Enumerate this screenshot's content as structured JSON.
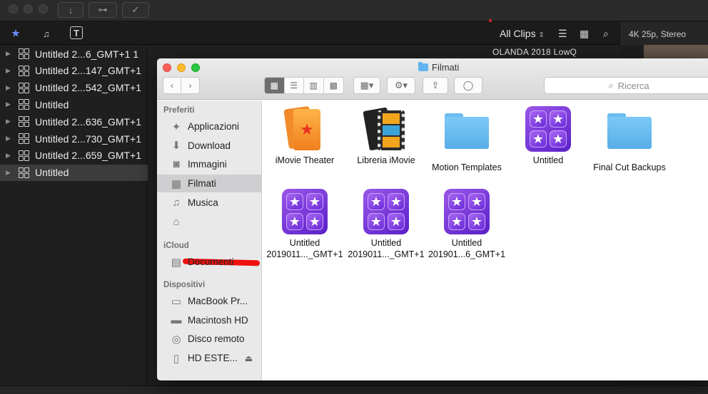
{
  "fcp": {
    "toolbar": {
      "import_icon": "↓",
      "key_icon": "⊶",
      "check_icon": "✓"
    },
    "library_tabs": [
      {
        "name": "libraries-tab",
        "glyph": "★"
      },
      {
        "name": "photos-audio-tab",
        "glyph": "♫"
      },
      {
        "name": "titles-tab",
        "glyph": "T"
      }
    ],
    "filter": {
      "label": "All Clips",
      "chevron": "⌃⌄"
    },
    "format_info": "4K 25p, Stereo",
    "clip_name": "OLANDA 2018 LowQ",
    "libraries": [
      {
        "label": "Untitled 2...6_GMT+1 1",
        "selected": false
      },
      {
        "label": "Untitled 2...147_GMT+1",
        "selected": false
      },
      {
        "label": "Untitled 2...542_GMT+1",
        "selected": false
      },
      {
        "label": "Untitled",
        "selected": false
      },
      {
        "label": "Untitled 2...636_GMT+1",
        "selected": false
      },
      {
        "label": "Untitled 2...730_GMT+1",
        "selected": false
      },
      {
        "label": "Untitled 2...659_GMT+1",
        "selected": false
      },
      {
        "label": "Untitled",
        "selected": true
      }
    ]
  },
  "finder": {
    "title": "Filmati",
    "search_placeholder": "Ricerca",
    "sidebar": {
      "favorites_header": "Preferiti",
      "favorites": [
        {
          "label": "Applicazioni",
          "icon": "apps-icon",
          "glyph": "✦"
        },
        {
          "label": "Download",
          "icon": "download-icon",
          "glyph": "⬇"
        },
        {
          "label": "Immagini",
          "icon": "camera-icon",
          "glyph": "◙"
        },
        {
          "label": "Filmati",
          "icon": "film-icon",
          "glyph": "▦",
          "selected": true
        },
        {
          "label": "Musica",
          "icon": "music-icon",
          "glyph": "♫"
        },
        {
          "label": "",
          "icon": "home-icon",
          "glyph": "⌂"
        }
      ],
      "icloud_header": "iCloud",
      "icloud": [
        {
          "label": "Documenti",
          "icon": "document-icon",
          "glyph": "▤"
        }
      ],
      "devices_header": "Dispositivi",
      "devices": [
        {
          "label": "MacBook Pr...",
          "icon": "laptop-icon",
          "glyph": "▭"
        },
        {
          "label": "Macintosh HD",
          "icon": "disk-icon",
          "glyph": "▬"
        },
        {
          "label": "Disco remoto",
          "icon": "disc-icon",
          "glyph": "◎"
        },
        {
          "label": "HD ESTE...",
          "icon": "external-drive-icon",
          "glyph": "▯",
          "eject": "⏏"
        }
      ]
    },
    "files": [
      {
        "line1": "iMovie Theater",
        "line2": "",
        "kind": "theater"
      },
      {
        "line1": "Libreria iMovie",
        "line2": "",
        "kind": "film"
      },
      {
        "line1": "Motion Templates",
        "line2": "",
        "kind": "folder"
      },
      {
        "line1": "Untitled",
        "line2": "",
        "kind": "library"
      },
      {
        "line1": "Final Cut Backups",
        "line2": "",
        "kind": "folder"
      },
      {
        "line1": "Untitled",
        "line2": "2019011..._GMT+1",
        "kind": "library"
      },
      {
        "line1": "Untitled",
        "line2": "2019011..._GMT+1",
        "kind": "library"
      },
      {
        "line1": "Untitled",
        "line2": "201901...6_GMT+1",
        "kind": "library"
      }
    ]
  },
  "colors": {
    "close": "#fc5f57",
    "minimize": "#fdbc2e",
    "zoom": "#28c840",
    "accent_folder": "#62b5ef",
    "library_purple": "#7a3fe0",
    "redaction": "#ef1010"
  }
}
